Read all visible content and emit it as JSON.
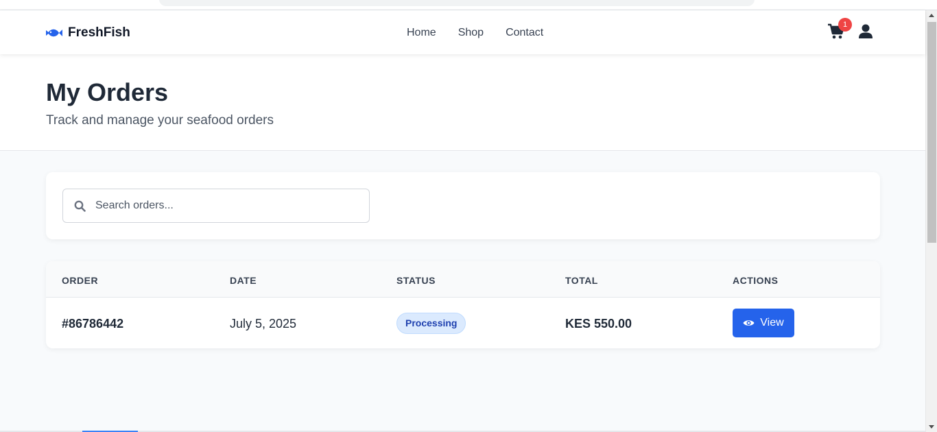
{
  "brand": {
    "name": "FreshFish",
    "accent": "#2563eb"
  },
  "nav": {
    "links": [
      "Home",
      "Shop",
      "Contact"
    ]
  },
  "cart": {
    "count": "1"
  },
  "header": {
    "title": "My Orders",
    "subtitle": "Track and manage your seafood orders"
  },
  "search": {
    "placeholder": "Search orders..."
  },
  "table": {
    "columns": [
      "ORDER",
      "DATE",
      "STATUS",
      "TOTAL",
      "ACTIONS"
    ],
    "rows": [
      {
        "order": "#86786442",
        "date": "July 5, 2025",
        "status": "Processing",
        "total": "KES 550.00",
        "action": "View"
      }
    ]
  },
  "colors": {
    "primary": "#2563eb",
    "badge": "#ef4444",
    "status_bg": "#dbeafe",
    "status_text": "#1e40af"
  }
}
